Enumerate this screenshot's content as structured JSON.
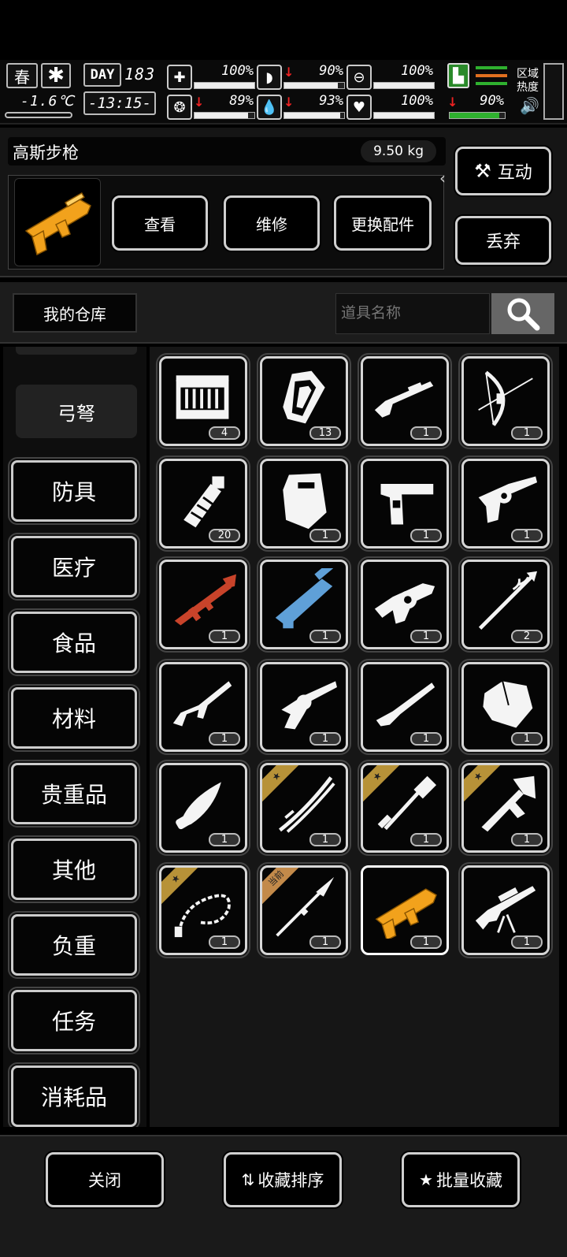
{
  "status": {
    "season": "春",
    "temperature": "-1.6℃",
    "day_label": "DAY",
    "day_number": "183",
    "time": "-13:15-",
    "stats": [
      {
        "name": "health",
        "value": "100%",
        "fill": 1.0,
        "down": false
      },
      {
        "name": "hunger",
        "value": "90%",
        "fill": 0.9,
        "down": true
      },
      {
        "name": "armor",
        "value": "100%",
        "fill": 1.0,
        "down": false
      },
      {
        "name": "mood",
        "value": "89%",
        "fill": 0.89,
        "down": true
      },
      {
        "name": "water",
        "value": "93%",
        "fill": 0.93,
        "down": true
      },
      {
        "name": "heart",
        "value": "100%",
        "fill": 1.0,
        "down": false
      }
    ],
    "stamina": {
      "value": "90%",
      "fill": 0.9,
      "down": true
    },
    "zone_label": "区域热度"
  },
  "item": {
    "name": "高斯步枪",
    "weight": "9.50 kg",
    "actions": {
      "view": "查看",
      "repair": "维修",
      "change_parts": "更换配件"
    },
    "interact": "互动",
    "discard": "丢弃"
  },
  "warehouse": {
    "title": "我的仓库",
    "search_placeholder": "道具名称"
  },
  "categories": [
    "弓弩",
    "防具",
    "医疗",
    "食品",
    "材料",
    "贵重品",
    "其他",
    "负重",
    "任务",
    "消耗品"
  ],
  "items": [
    {
      "icon": "ammo-crate-icon",
      "count": "4"
    },
    {
      "icon": "magazine-icon",
      "count": "13"
    },
    {
      "icon": "shotgun-icon",
      "count": "1"
    },
    {
      "icon": "compound-bow-icon",
      "count": "1"
    },
    {
      "icon": "grenade-icon",
      "count": "20"
    },
    {
      "icon": "riot-shield-icon",
      "count": "1"
    },
    {
      "icon": "desert-eagle-icon",
      "count": "1"
    },
    {
      "icon": "revolver-icon",
      "count": "1"
    },
    {
      "icon": "rocket-launcher-icon",
      "count": "1"
    },
    {
      "icon": "minigun-icon",
      "count": "1"
    },
    {
      "icon": "grenade-launcher-icon",
      "count": "1"
    },
    {
      "icon": "spear-icon",
      "count": "2"
    },
    {
      "icon": "assault-rifle-icon",
      "count": "1"
    },
    {
      "icon": "old-revolver-icon",
      "count": "1"
    },
    {
      "icon": "hunting-rifle-icon",
      "count": "1"
    },
    {
      "icon": "ore-icon",
      "count": "1"
    },
    {
      "icon": "knife-icon",
      "count": "1"
    },
    {
      "icon": "katana-icon",
      "count": "1",
      "fav": true
    },
    {
      "icon": "shovel-icon",
      "count": "1",
      "fav": true
    },
    {
      "icon": "axe-icon",
      "count": "1",
      "fav": true
    },
    {
      "icon": "whip-icon",
      "count": "1",
      "fav": true
    },
    {
      "icon": "spear-tip-icon",
      "count": "1",
      "tag": "当前"
    },
    {
      "icon": "gauss-rifle-icon",
      "count": "1",
      "selected": true
    },
    {
      "icon": "sniper-rifle-icon",
      "count": "1"
    }
  ],
  "footer": {
    "close": "关闭",
    "sort_favorites": "收藏排序",
    "batch_favorite": "批量收藏"
  },
  "colors": {
    "gold": "#f2a21c",
    "favorite_ribbon": "#b79238",
    "rocket": "#c8432a",
    "minigun": "#5fa0d8"
  }
}
